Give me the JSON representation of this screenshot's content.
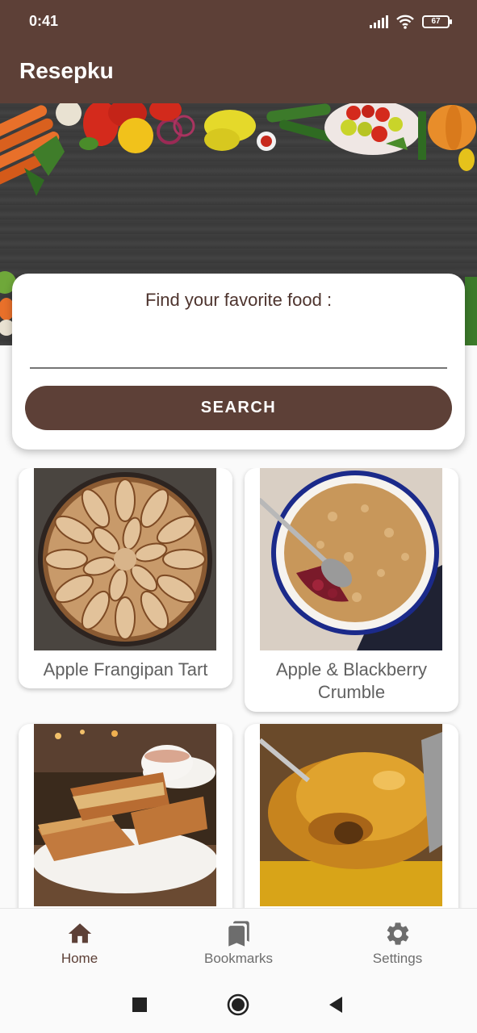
{
  "status": {
    "time": "0:41",
    "battery": "67"
  },
  "app": {
    "title": "Resepku"
  },
  "search": {
    "title": "Find your favorite food :",
    "value": "",
    "button_label": "SEARCH"
  },
  "recipes": [
    {
      "title": "Apple Frangipan Tart"
    },
    {
      "title": "Apple & Blackberry Crumble"
    },
    {
      "title": ""
    },
    {
      "title": ""
    }
  ],
  "bottom_nav": {
    "items": [
      {
        "label": "Home",
        "icon": "home-icon",
        "active": true
      },
      {
        "label": "Bookmarks",
        "icon": "bookmarks-icon",
        "active": false
      },
      {
        "label": "Settings",
        "icon": "settings-icon",
        "active": false
      }
    ]
  },
  "colors": {
    "primary": "#5d4037",
    "active_nav": "#5d4037",
    "inactive_nav": "#6d6d6d"
  }
}
